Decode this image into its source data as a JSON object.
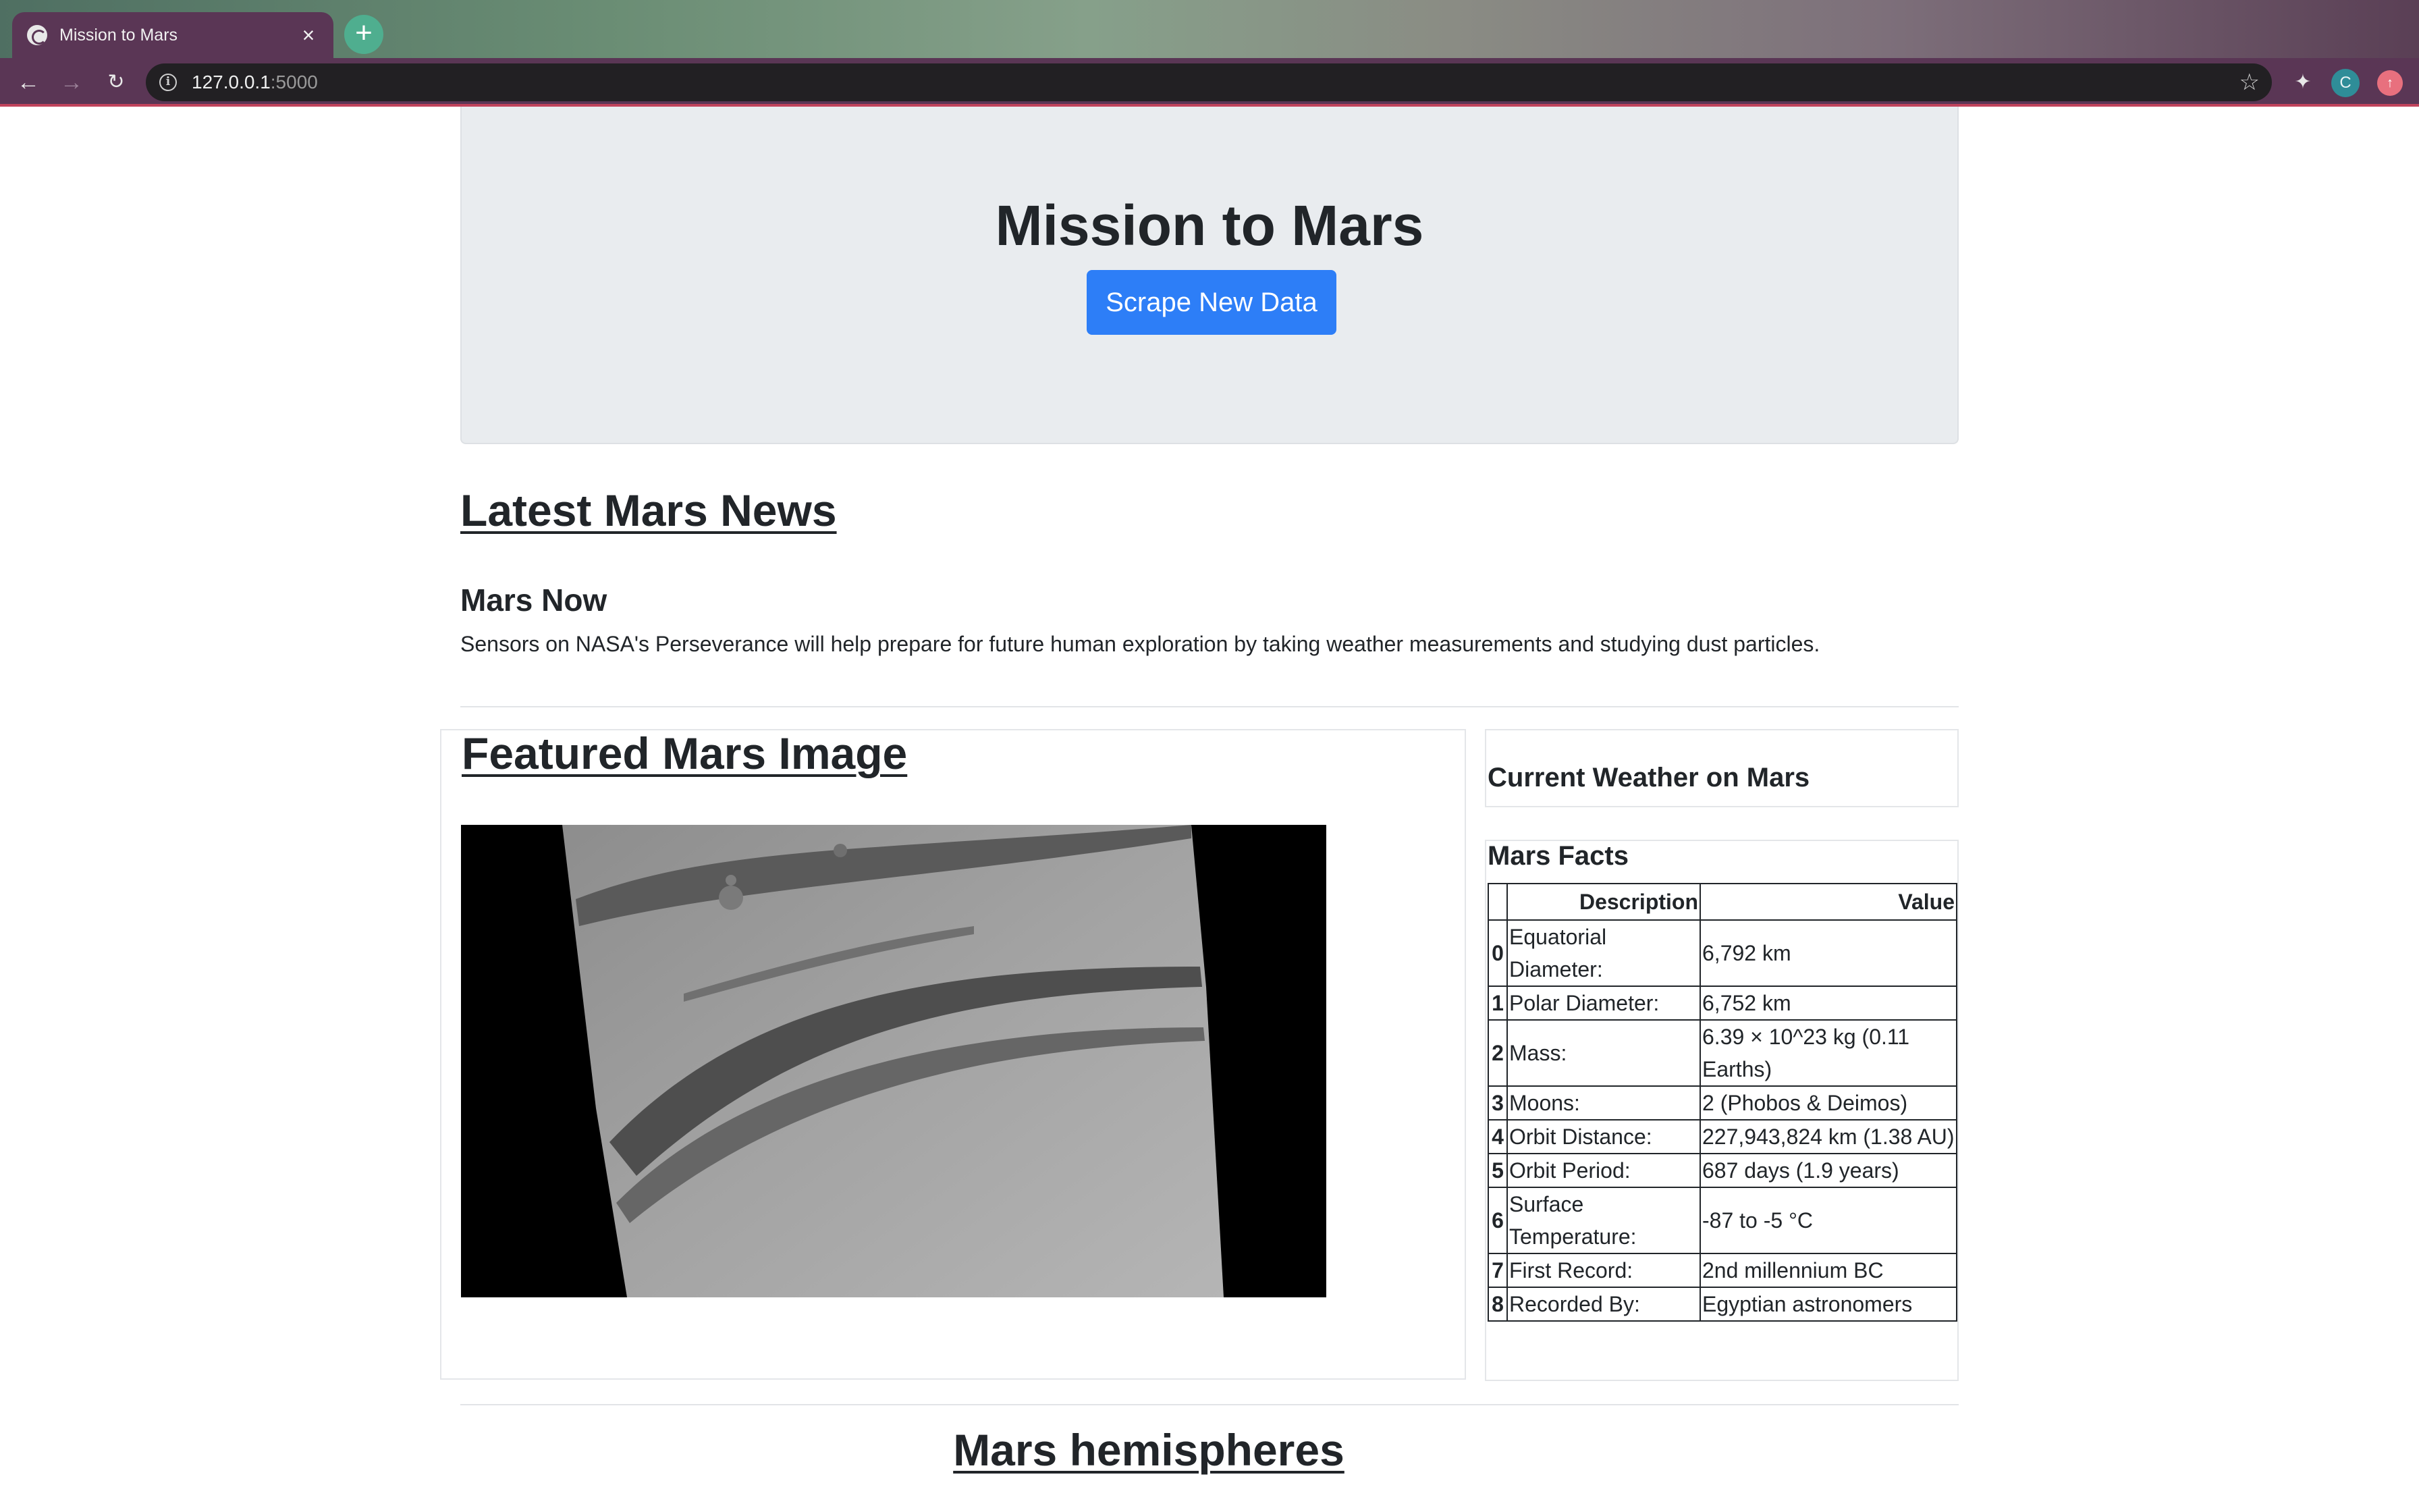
{
  "browser": {
    "tab_title": "Mission to Mars",
    "tab_close": "×",
    "new_tab": "+",
    "url_host": "127.0.0.1",
    "url_port": ":5000",
    "profile_initial": "C"
  },
  "header": {
    "title": "Mission to Mars",
    "scrape_button": "Scrape New Data"
  },
  "news": {
    "heading": "Latest Mars News",
    "title": "Mars Now",
    "paragraph": "Sensors on NASA's Perseverance will help prepare for future human exploration by taking weather measurements and studying dust particles."
  },
  "featured": {
    "heading": "Featured Mars Image"
  },
  "weather": {
    "heading": "Current Weather on Mars"
  },
  "facts": {
    "heading": "Mars Facts",
    "columns": [
      "Description",
      "Value"
    ],
    "rows": [
      {
        "index": "0",
        "description": "Equatorial Diameter:",
        "value": "6,792 km"
      },
      {
        "index": "1",
        "description": "Polar Diameter:",
        "value": "6,752 km"
      },
      {
        "index": "2",
        "description": "Mass:",
        "value": "6.39 × 10^23 kg (0.11 Earths)"
      },
      {
        "index": "3",
        "description": "Moons:",
        "value": "2 (Phobos & Deimos)"
      },
      {
        "index": "4",
        "description": "Orbit Distance:",
        "value": "227,943,824 km (1.38 AU)"
      },
      {
        "index": "5",
        "description": "Orbit Period:",
        "value": "687 days (1.9 years)"
      },
      {
        "index": "6",
        "description": "Surface Temperature:",
        "value": "-87 to -5 °C"
      },
      {
        "index": "7",
        "description": "First Record:",
        "value": "2nd millennium BC"
      },
      {
        "index": "8",
        "description": "Recorded By:",
        "value": "Egyptian astronomers"
      }
    ]
  },
  "hemispheres": {
    "heading": "Mars hemispheres"
  },
  "colors": {
    "accent_button": "#2d7ef7",
    "jumbotron_bg": "#e9ecef",
    "browser_frame": "#5a3655"
  },
  "icons": [
    "globe-icon",
    "close-icon",
    "plus-icon",
    "back-arrow-icon",
    "forward-arrow-icon",
    "reload-icon",
    "info-icon",
    "star-icon",
    "puzzle-icon",
    "profile-icon",
    "update-icon"
  ]
}
